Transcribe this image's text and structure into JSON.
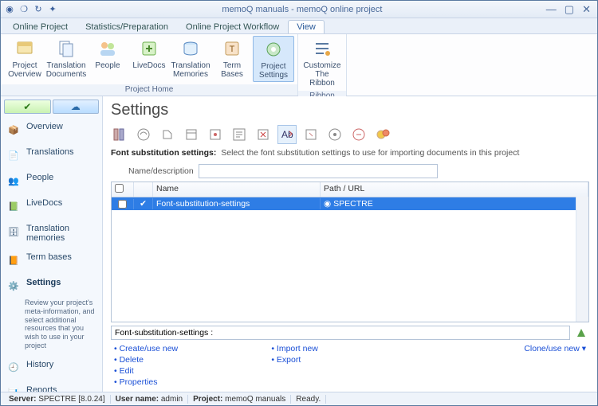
{
  "titlebar": {
    "title": "memoQ manuals - memoQ online project"
  },
  "ribbon_tabs": [
    "Online Project",
    "Statistics/Preparation",
    "Online Project Workflow",
    "View"
  ],
  "ribbon_active_tab_index": 3,
  "ribbon": {
    "group1": {
      "label": "Project Home",
      "btns": [
        "Project\nOverview",
        "Translation\nDocuments",
        "People",
        "LiveDocs",
        "Translation\nMemories",
        "Term Bases",
        "Project\nSettings"
      ]
    },
    "group2": {
      "label": "Ribbon",
      "btns": [
        "Customize\nThe Ribbon"
      ]
    }
  },
  "nav": {
    "items": [
      "Overview",
      "Translations",
      "People",
      "LiveDocs",
      "Translation memories",
      "Term bases",
      "Settings",
      "History",
      "Reports"
    ],
    "active_index": 6,
    "settings_desc": "Review your project's meta-information, and select additional resources that you wish to use in your project"
  },
  "content": {
    "heading": "Settings",
    "desc_label": "Font substitution settings:",
    "desc_text": "Select the font substitution settings to use for importing documents in this project",
    "filter_label": "Name/description",
    "grid": {
      "headers": {
        "name": "Name",
        "path": "Path / URL"
      },
      "row": {
        "name": "Font-substitution-settings",
        "path": "SPECTRE"
      }
    },
    "crumb": "Font-substitution-settings :",
    "links": {
      "col1": [
        "Create/use new",
        "Delete",
        "Edit",
        "Properties"
      ],
      "col2": [
        "Import new",
        "Export"
      ],
      "right": "Clone/use new"
    }
  },
  "status": {
    "server_label": "Server:",
    "server": "SPECTRE [8.0.24]",
    "user_label": "User name:",
    "user": "admin",
    "project_label": "Project:",
    "project": "memoQ manuals",
    "state": "Ready."
  }
}
